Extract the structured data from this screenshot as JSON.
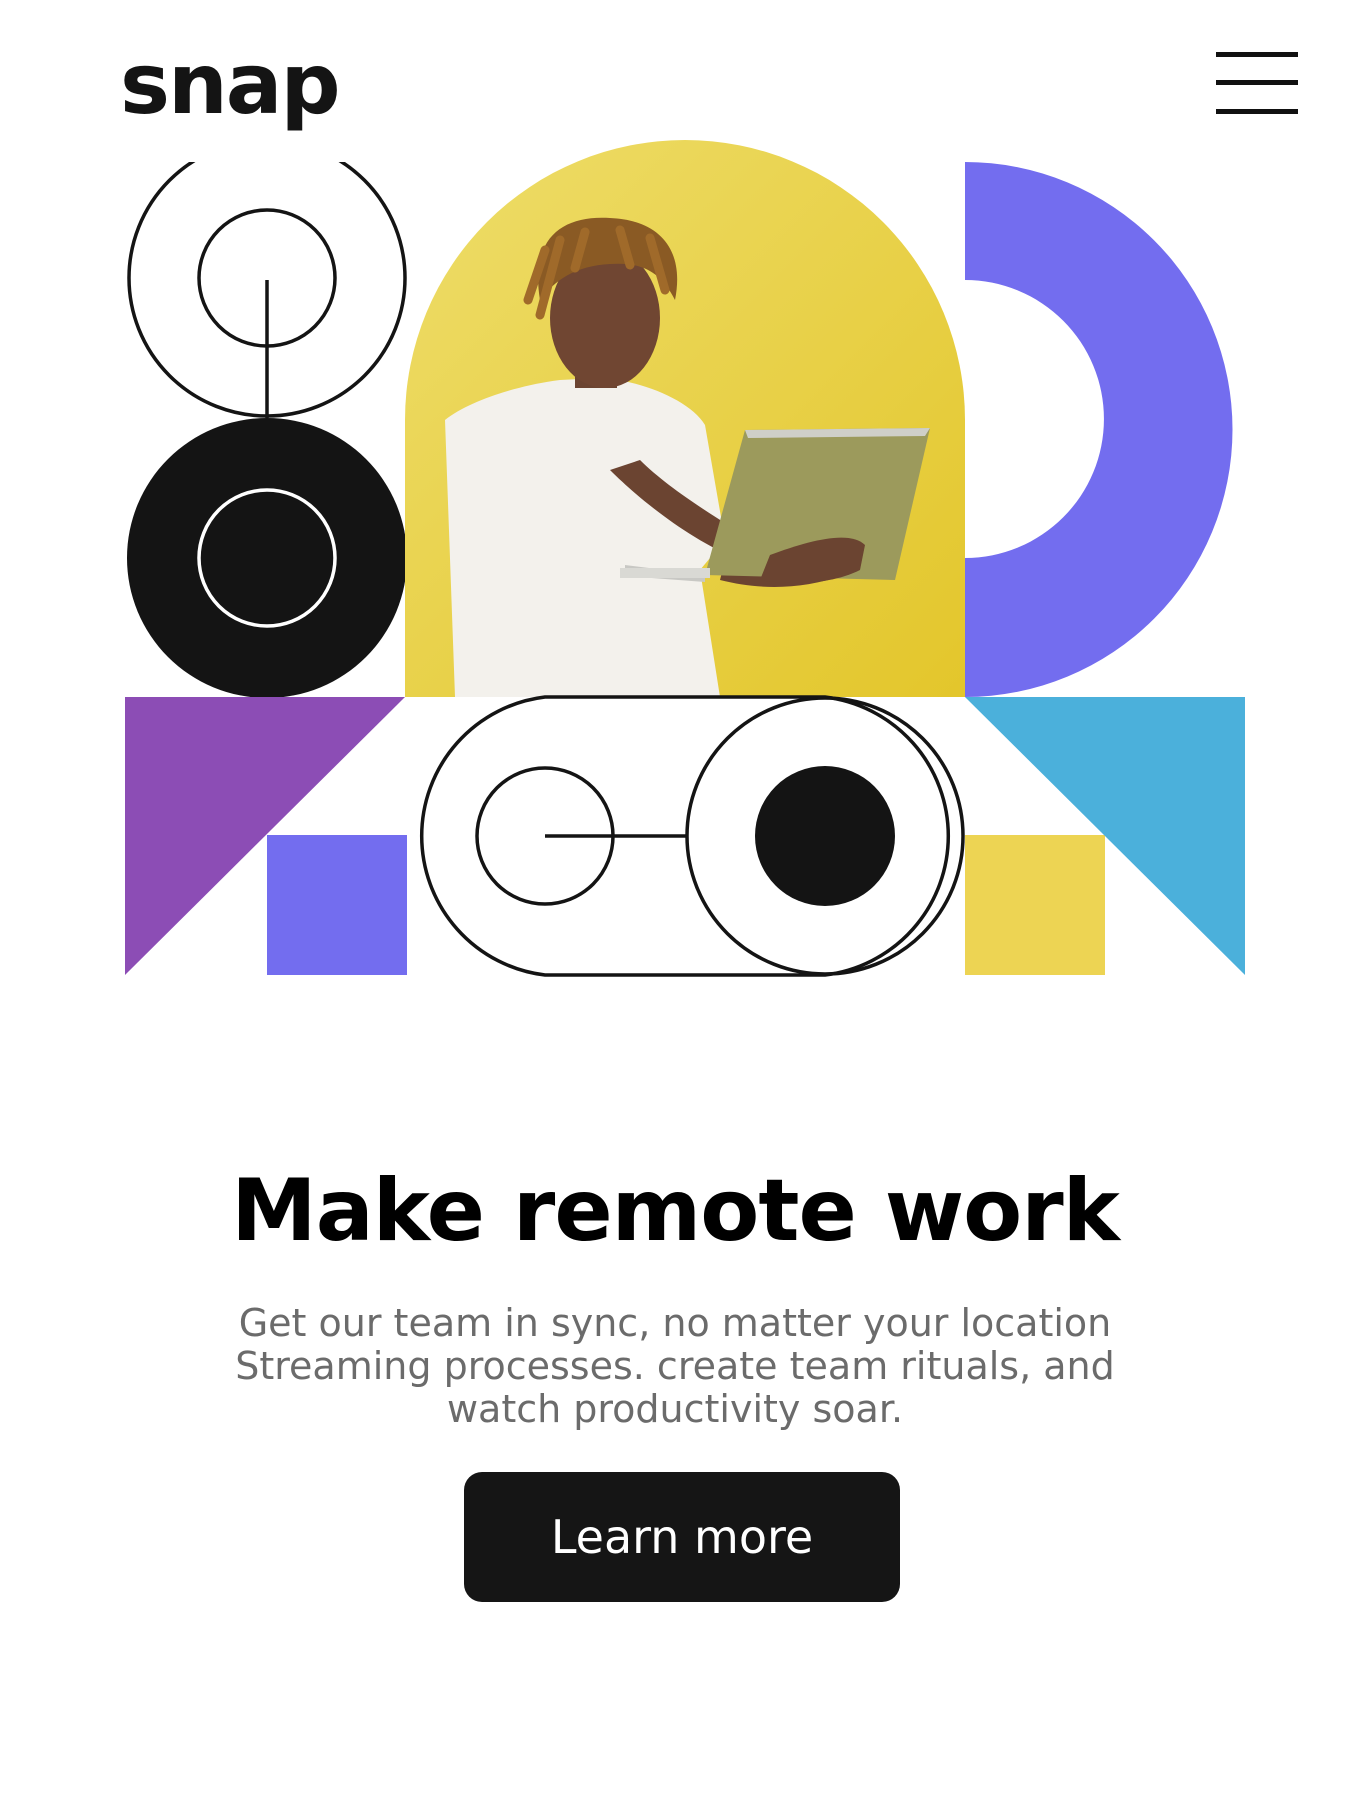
{
  "header": {
    "logo_text": "snap",
    "menu_icon": "hamburger-menu-icon"
  },
  "hero": {
    "image_description_icon": "person-with-laptop-photo",
    "colors": {
      "yellow": "#E8D43A",
      "violet": "#736DEF",
      "purple": "#8C4DB5",
      "sky": "#4BB0DB",
      "square_yellow": "#EDD453",
      "black": "#141414"
    }
  },
  "main": {
    "headline": "Make remote work",
    "description": "Get our team in sync, no matter your location Streaming processes. create team rituals, and watch productivity soar.",
    "cta_label": "Learn more"
  }
}
